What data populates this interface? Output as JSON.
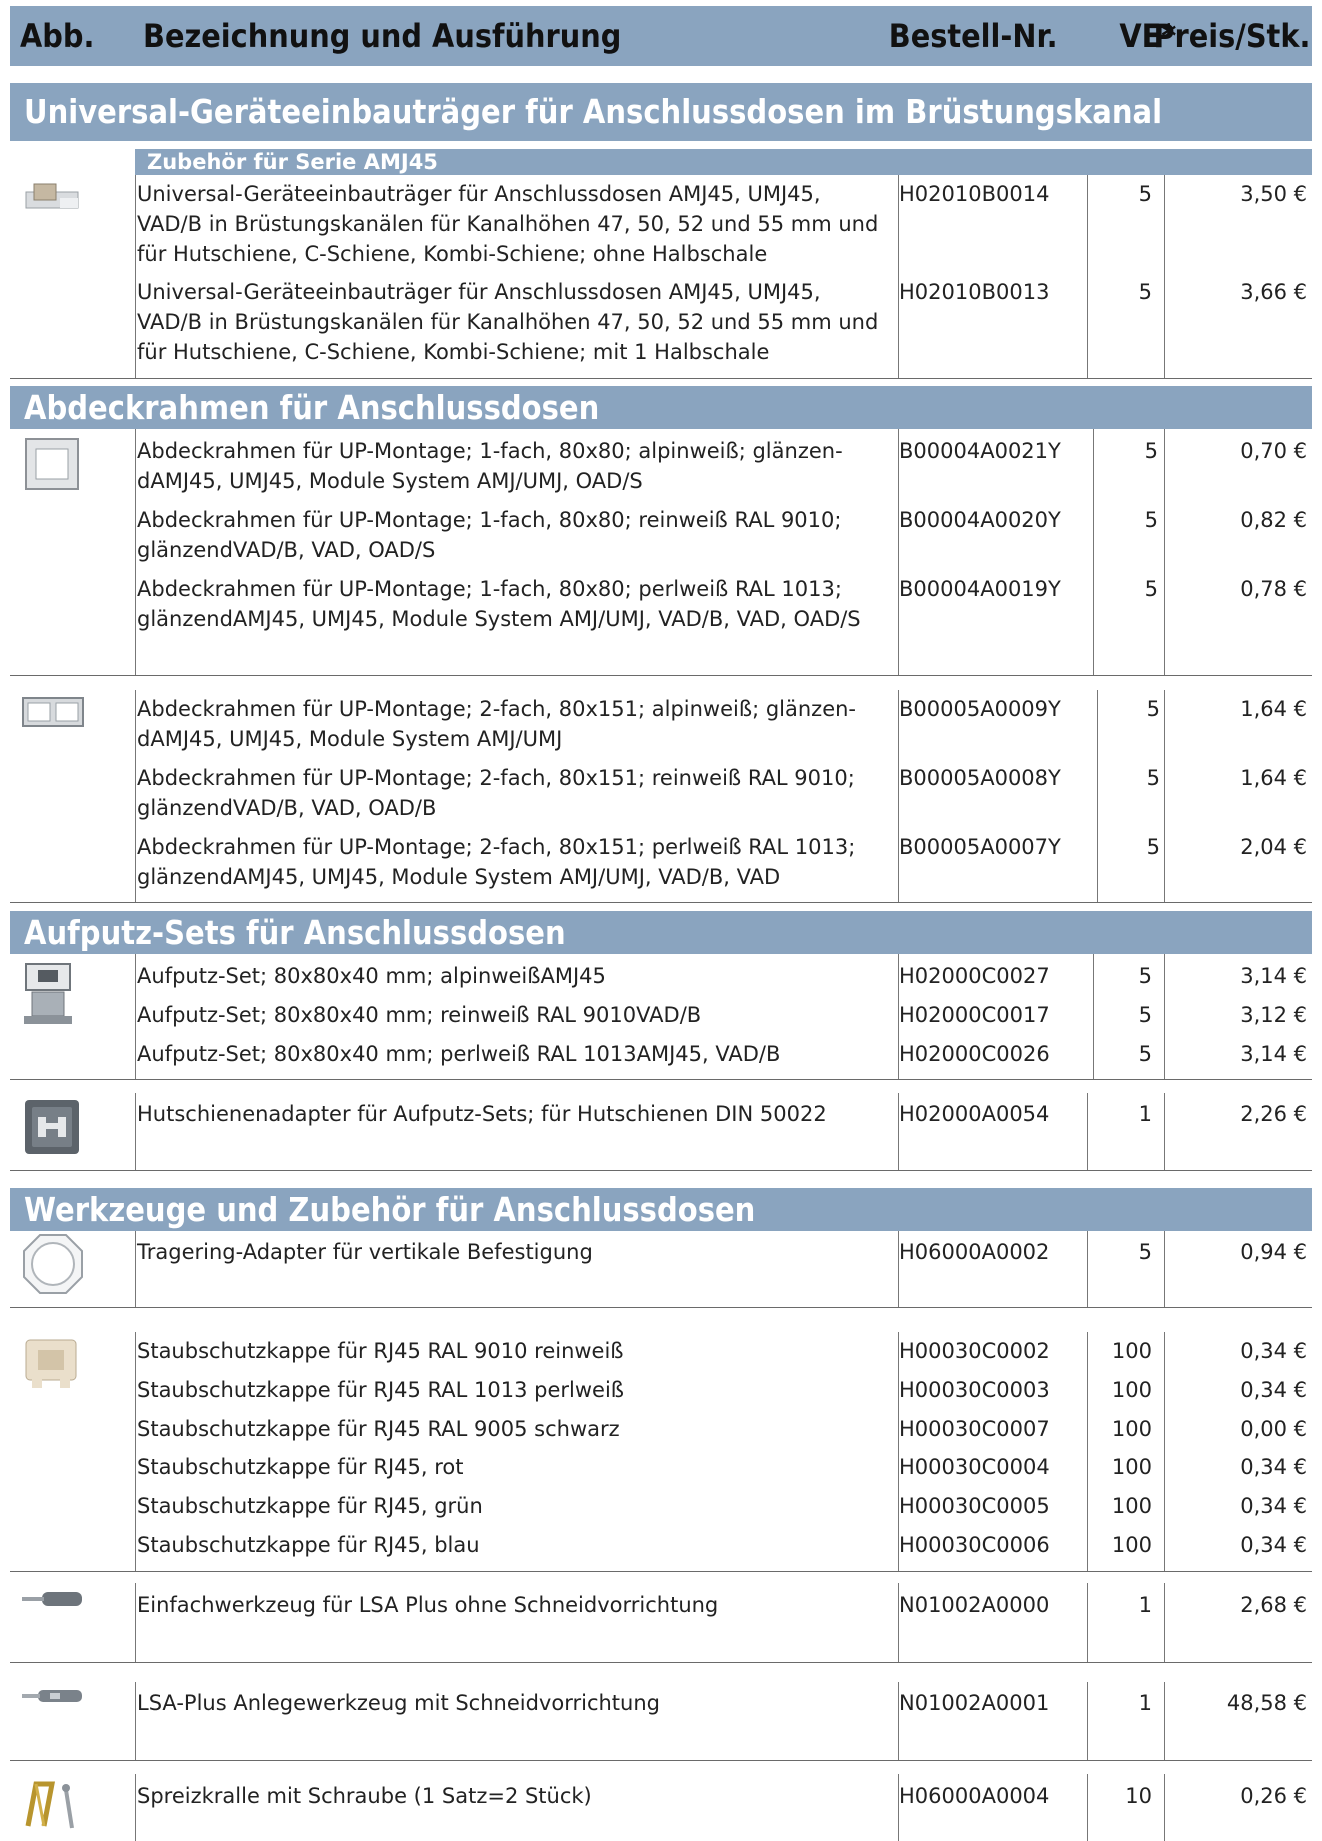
{
  "header": {
    "abb": "Abb.",
    "bezeichnung": "Bezeichnung und Ausführung",
    "bestellnr": "Bestell-Nr.",
    "ve": "VE*",
    "preis": "Preis/Stk."
  },
  "sections": {
    "universal": {
      "title": "Universal-Geräteeinbauträger für Anschlussdosen im Brüstungskanal",
      "sub": "Zubehör für Serie AMJ45",
      "items": [
        {
          "desc": "Universal-Geräteeinbauträger für Anschlussdosen AMJ45, UMJ45, VAD/B in Brüstungskanälen für Kanalhöhen 47, 50, 52 und 55 mm und für Hutschiene, C-Schiene, Kombi-Schiene; ohne Halbschale",
          "code": "H02010B0014",
          "ve": "5",
          "price": "3,50 €"
        },
        {
          "desc": "Universal-Geräteeinbauträger für Anschlussdosen AMJ45, UMJ45, VAD/B in Brüstungskanälen für Kanalhöhen 47, 50, 52 und 55 mm und für Hutschiene, C-Schiene, Kombi-Schiene; mit 1 Halbschale",
          "code": "H02010B0013",
          "ve": "5",
          "price": "3,66 €"
        }
      ]
    },
    "abdeck": {
      "title": "Abdeckrahmen für Anschlussdosen",
      "group1": [
        {
          "desc": "Abdeckrahmen für UP-Montage; 1-fach, 80x80; alpinweiß; glänzen-dAMJ45, UMJ45, Module System AMJ/UMJ, OAD/S",
          "code": "B00004A0021Y",
          "ve": "5",
          "price": "0,70 €"
        },
        {
          "desc": "Abdeckrahmen für UP-Montage; 1-fach, 80x80; reinweiß RAL 9010; glänzendVAD/B, VAD, OAD/S",
          "code": "B00004A0020Y",
          "ve": "5",
          "price": "0,82 €"
        },
        {
          "desc": "Abdeckrahmen für UP-Montage; 1-fach, 80x80; perlweiß RAL 1013; glänzendAMJ45, UMJ45, Module System AMJ/UMJ, VAD/B, VAD, OAD/S",
          "code": "B00004A0019Y",
          "ve": "5",
          "price": "0,78 €"
        }
      ],
      "group2": [
        {
          "desc": "Abdeckrahmen für UP-Montage; 2-fach, 80x151; alpinweiß; glänzen-dAMJ45, UMJ45, Module System AMJ/UMJ",
          "code": "B00005A0009Y",
          "ve": "5",
          "price": "1,64 €"
        },
        {
          "desc": "Abdeckrahmen für UP-Montage; 2-fach, 80x151; reinweiß RAL 9010; glänzendVAD/B, VAD, OAD/B",
          "code": "B00005A0008Y",
          "ve": "5",
          "price": "1,64 €"
        },
        {
          "desc": "Abdeckrahmen für UP-Montage; 2-fach, 80x151; perlweiß RAL 1013; glänzendAMJ45, UMJ45, Module System AMJ/UMJ, VAD/B, VAD",
          "code": "B00005A0007Y",
          "ve": "5",
          "price": "2,04 €"
        }
      ]
    },
    "aufputz": {
      "title": "Aufputz-Sets für Anschlussdosen",
      "group1": [
        {
          "desc": "Aufputz-Set; 80x80x40 mm; alpinweißAMJ45",
          "code": "H02000C0027",
          "ve": "5",
          "price": "3,14 €"
        },
        {
          "desc": "Aufputz-Set; 80x80x40 mm; reinweiß RAL 9010VAD/B",
          "code": "H02000C0017",
          "ve": "5",
          "price": "3,12 €"
        },
        {
          "desc": "Aufputz-Set; 80x80x40 mm; perlweiß RAL 1013AMJ45, VAD/B",
          "code": "H02000C0026",
          "ve": "5",
          "price": "3,14 €"
        }
      ],
      "group2": [
        {
          "desc": "Hutschienenadapter für Aufputz-Sets; für Hutschienen DIN 50022",
          "code": "H02000A0054",
          "ve": "1",
          "price": "2,26 €"
        }
      ]
    },
    "werkzeuge": {
      "title": "Werkzeuge und Zubehör für Anschlussdosen",
      "tragering": {
        "desc": "Tragering-Adapter für vertikale Befestigung",
        "code": "H06000A0002",
        "ve": "5",
        "price": "0,94 €"
      },
      "staub": [
        {
          "desc": "Staubschutzkappe für RJ45 RAL 9010 reinweiß",
          "code": "H00030C0002",
          "ve": "100",
          "price": "0,34 €"
        },
        {
          "desc": "Staubschutzkappe für RJ45 RAL 1013 perlweiß",
          "code": "H00030C0003",
          "ve": "100",
          "price": "0,34 €"
        },
        {
          "desc": "Staubschutzkappe für RJ45 RAL 9005 schwarz",
          "code": "H00030C0007",
          "ve": "100",
          "price": "0,00 €"
        },
        {
          "desc": "Staubschutzkappe für RJ45, rot",
          "code": "H00030C0004",
          "ve": "100",
          "price": "0,34 €"
        },
        {
          "desc": "Staubschutzkappe für RJ45, grün",
          "code": "H00030C0005",
          "ve": "100",
          "price": "0,34 €"
        },
        {
          "desc": "Staubschutzkappe für RJ45, blau",
          "code": "H00030C0006",
          "ve": "100",
          "price": "0,34 €"
        }
      ],
      "einfach": {
        "desc": "Einfachwerkzeug für LSA Plus ohne Schneidvorrichtung",
        "code": "N01002A0000",
        "ve": "1",
        "price": "2,68 €"
      },
      "lsa": {
        "desc": "LSA-Plus Anlegewerkzeug mit Schneidvorrichtung",
        "code": "N01002A0001",
        "ve": "1",
        "price": "48,58 €"
      },
      "spreiz": {
        "desc": "Spreizkralle mit Schraube (1 Satz=2 Stück)",
        "code": "H06000A0004",
        "ve": "10",
        "price": "0,26 €"
      }
    }
  }
}
